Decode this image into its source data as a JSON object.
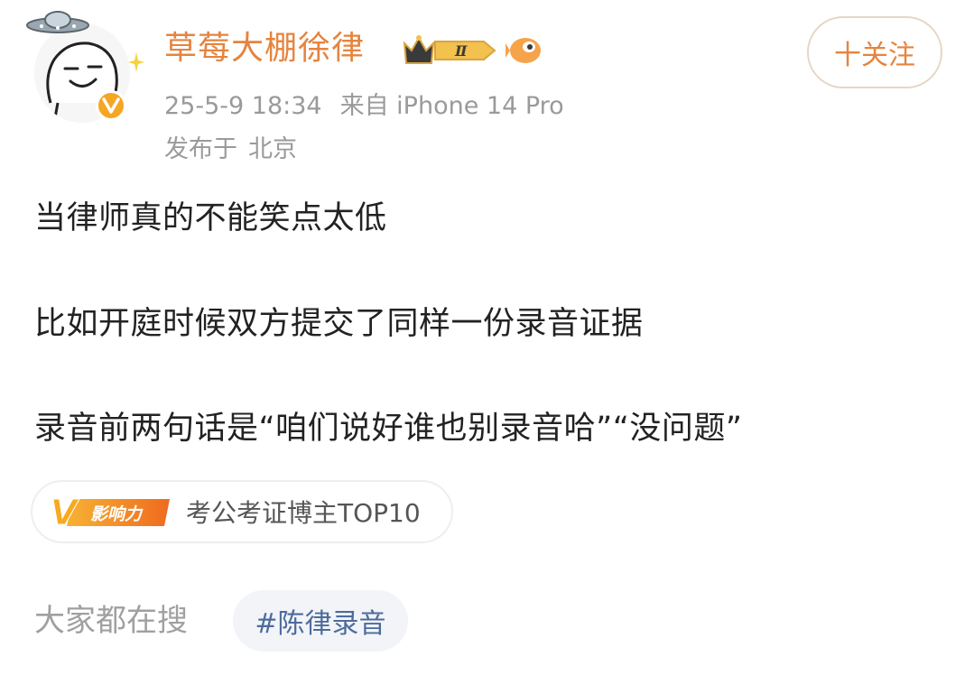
{
  "user": {
    "name": "草莓大棚徐律",
    "level_badge_text": "Ⅱ"
  },
  "post": {
    "time": "25-5-9 18:34",
    "source": "来自 iPhone 14 Pro",
    "location_prefix": "发布于",
    "location": "北京",
    "lines": [
      "当律师真的不能笑点太低",
      "比如开庭时候双方提交了同样一份录音证据",
      "录音前两句话是“咱们说好谁也别录音哈”“没问题”"
    ]
  },
  "follow_button": {
    "label": "十关注"
  },
  "influence": {
    "logo_letter": "V",
    "logo_text": "影响力",
    "label": "考公考证博主TOP10"
  },
  "search": {
    "label": "大家都在搜",
    "tag": "#陈律录音"
  },
  "colors": {
    "username": "#e5843e",
    "meta": "#9a9a9a",
    "body_text": "#222222",
    "topic_tag_text": "#4d6b9c",
    "topic_tag_bg": "#f2f4f8",
    "verified_badge": "#f5a623"
  },
  "icons": {
    "avatar": "meme-face-avatar",
    "decoration": "ufo-icon",
    "verified": "verified-v-icon",
    "level": "crown-level-badge-icon",
    "fan": "fish-fan-badge-icon",
    "influence": "influence-v-logo-icon"
  }
}
